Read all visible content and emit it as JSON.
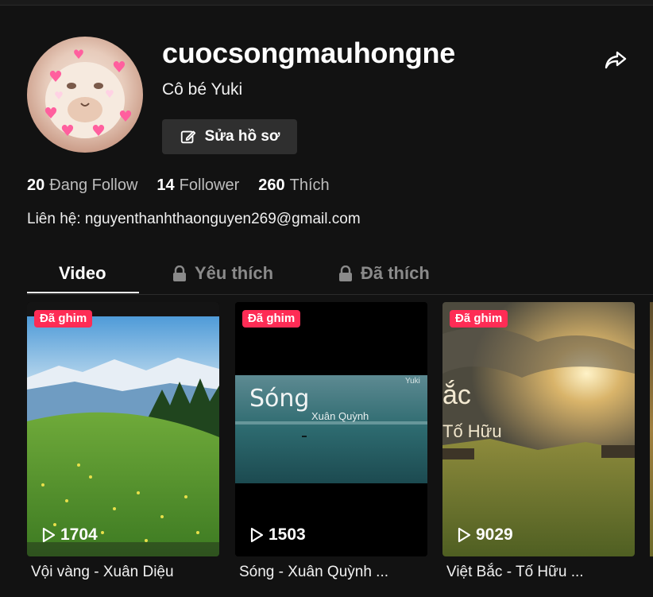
{
  "profile": {
    "username": "cuocsongmauhongne",
    "nickname": "Cô bé Yuki",
    "edit_label": "Sửa hồ sơ",
    "contact": "Liên hệ: nguyenthanhthaonguyen269@gmail.com"
  },
  "stats": [
    {
      "value": "20",
      "label": "Đang Follow"
    },
    {
      "value": "14",
      "label": "Follower"
    },
    {
      "value": "260",
      "label": "Thích"
    }
  ],
  "tabs": [
    {
      "label": "Video",
      "locked": false,
      "active": true
    },
    {
      "label": "Yêu thích",
      "locked": true,
      "active": false
    },
    {
      "label": "Đã thích",
      "locked": true,
      "active": false
    }
  ],
  "videos": [
    {
      "pin_label": "Đã ghim",
      "views": "1704",
      "caption": "Vội vàng - Xuân Diệu"
    },
    {
      "pin_label": "Đã ghim",
      "views": "1503",
      "caption": "Sóng - Xuân Quỳnh ...",
      "overlay_title": "Sóng",
      "overlay_author": "Xuân Quỳnh",
      "overlay_corner": "Yuki"
    },
    {
      "pin_label": "Đã ghim",
      "views": "9029",
      "caption": "Việt Bắc - Tố Hữu ...",
      "overlay_title": "ắc",
      "overlay_author": "Tố Hữu"
    }
  ],
  "icons": {
    "share": "share-arrow-icon",
    "edit": "edit-icon",
    "lock": "lock-icon",
    "play": "play-icon"
  },
  "colors": {
    "background": "#121212",
    "pin_badge": "#fe2c55",
    "button": "#2f2f2f"
  }
}
